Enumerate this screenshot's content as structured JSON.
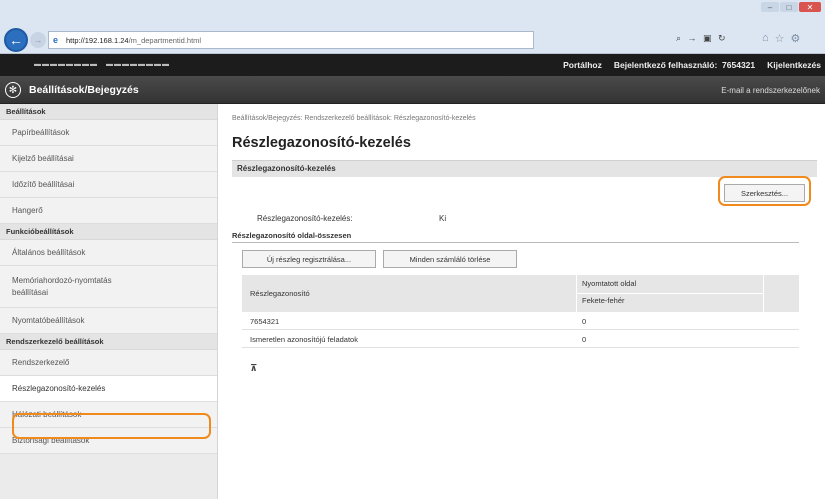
{
  "browser": {
    "url_host": "http://192.168.1.24",
    "url_path": "/m_departmentid.html",
    "address_tools": "⌕ → ▣ ↻"
  },
  "topbar": {
    "portal_label": "Portálhoz",
    "user_label": "Bejelentkező felhasználó:",
    "user_id": "7654321",
    "logout_label": "Kijelentkezés"
  },
  "header": {
    "title": "Beállítások/Bejegyzés",
    "mail_link": "E-mail a rendszerkezelőnek"
  },
  "sidebar": {
    "groups": {
      "settings": "Beállítások",
      "function": "Funkcióbeállítások",
      "admin": "Rendszerkezelő beállítások"
    },
    "items": {
      "paper": "Papírbeállítások",
      "display": "Kijelző beállításai",
      "timer": "Időzítő beállításai",
      "sound": "Hangerő",
      "general": "Általános beállítások",
      "memory_line1": "Memóriahordozó-nyomtatás",
      "memory_line2": "beállításai",
      "printer": "Nyomtatóbeállítások",
      "sysadmin": "Rendszerkezelő",
      "dept_id": "Részlegazonosító-kezelés",
      "network": "Hálózati beállítások",
      "security": "Biztonsági beállítások"
    }
  },
  "main": {
    "breadcrumb": "Beállítások/Bejegyzés: Rendszerkezelő beállítások: Részlegazonosító-kezelés",
    "page_title": "Részlegazonosító-kezelés",
    "section_title": "Részlegazonosító-kezelés",
    "edit_button": "Szerkesztés...",
    "status_label": "Részlegazonosító-kezelés:",
    "status_value": "Ki",
    "page_totals_title": "Részlegazonosító oldal-összesen",
    "register_button": "Új részleg regisztrálása...",
    "clear_counters_button": "Minden számláló törlése",
    "table": {
      "col_id": "Részlegazonosító",
      "col_printed": "Nyomtatott oldal",
      "col_bw": "Fekete-fehér",
      "rows": [
        {
          "id": "7654321",
          "bw": "0"
        },
        {
          "id": "Ismeretlen azonosítójú feladatok",
          "bw": "0"
        }
      ]
    }
  }
}
